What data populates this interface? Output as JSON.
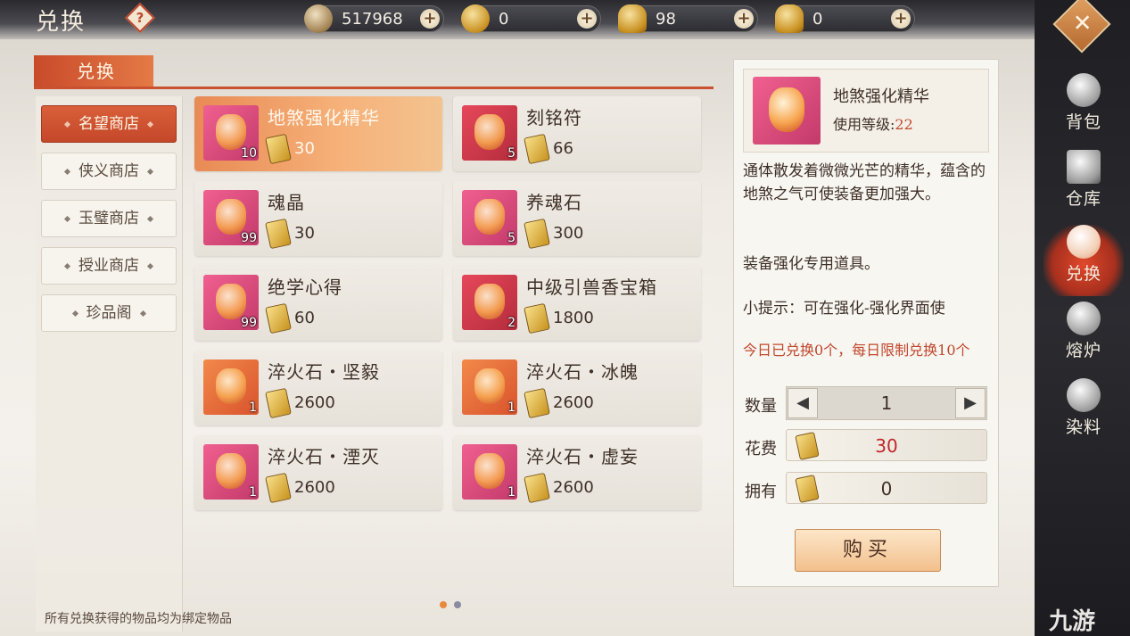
{
  "header": {
    "title": "兑换",
    "help_icon": "question-icon"
  },
  "currencies": [
    {
      "icon": "copper-coin-icon",
      "value": "517968"
    },
    {
      "icon": "gold-coin-icon",
      "value": "0"
    },
    {
      "icon": "silver-ingot-icon",
      "value": "98"
    },
    {
      "icon": "gold-ingot-icon",
      "value": "0"
    }
  ],
  "tab": {
    "label": "兑换"
  },
  "shops": [
    "名望商店",
    "侠义商店",
    "玉璧商店",
    "授业商店",
    "珍品阁"
  ],
  "items": [
    {
      "name": "地煞强化精华",
      "count": "10",
      "price": "30",
      "color": "pink"
    },
    {
      "name": "刻铭符",
      "count": "5",
      "price": "66",
      "color": "red"
    },
    {
      "name": "魂晶",
      "count": "99",
      "price": "30",
      "color": "pink"
    },
    {
      "name": "养魂石",
      "count": "5",
      "price": "300",
      "color": "pink"
    },
    {
      "name": "绝学心得",
      "count": "99",
      "price": "60",
      "color": "pink"
    },
    {
      "name": "中级引兽香宝箱",
      "count": "2",
      "price": "1800",
      "color": "red"
    },
    {
      "name": "淬火石・坚毅",
      "count": "1",
      "price": "2600",
      "color": "orange"
    },
    {
      "name": "淬火石・冰魄",
      "count": "1",
      "price": "2600",
      "color": "orange"
    },
    {
      "name": "淬火石・湮灭",
      "count": "1",
      "price": "2600",
      "color": "pink"
    },
    {
      "name": "淬火石・虚妄",
      "count": "1",
      "price": "2600",
      "color": "pink"
    }
  ],
  "footnote": "所有兑换获得的物品均为绑定物品",
  "detail": {
    "name": "地煞强化精华",
    "level_label": "使用等级:",
    "level_value": "22",
    "description": "通体散发着微微光芒的精华，蕴含的地煞之气可使装备更加强大。",
    "usage": "装备强化专用道具。",
    "tip": "小提示：可在强化-强化界面使",
    "limit": "今日已兑换0个，每日限制兑换10个",
    "qty_label": "数量",
    "qty_value": "1",
    "cost_label": "花费",
    "cost_value": "30",
    "own_label": "拥有",
    "own_value": "0",
    "buy_label": "购买"
  },
  "nav": [
    {
      "label": "背包",
      "icon": "bag-icon"
    },
    {
      "label": "仓库",
      "icon": "warehouse-icon"
    },
    {
      "label": "兑换",
      "icon": "exchange-icon"
    },
    {
      "label": "熔炉",
      "icon": "furnace-icon"
    },
    {
      "label": "染料",
      "icon": "dye-icon"
    }
  ],
  "watermark": "九游",
  "colors": {
    "accent": "#c94a2b",
    "limit_text": "#c0472c",
    "cost_text": "#c0272c"
  }
}
